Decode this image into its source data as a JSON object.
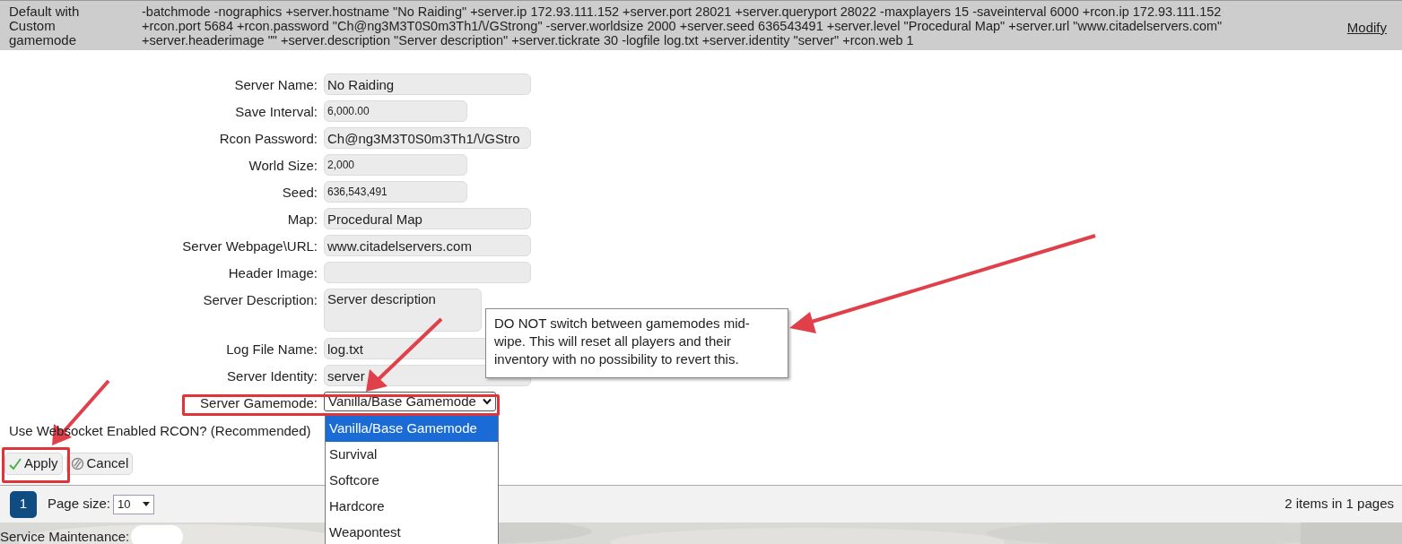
{
  "header_row": {
    "name_lines": [
      "Default with",
      "Custom",
      "gamemode"
    ],
    "command_lines": [
      "-batchmode -nographics +server.hostname \"No Raiding\" +server.ip 172.93.111.152 +server.port 28021 +server.queryport 28022 -maxplayers 15 -saveinterval 6000 +rcon.ip 172.93.111.152",
      "+rcon.port 5684 +rcon.password \"Ch@ng3M3T0S0m3Th1/\\/GStrong\" -server.worldsize 2000 +server.seed 636543491 +server.level \"Procedural Map\" +server.url \"www.citadelservers.com\"",
      "+server.headerimage \"\" +server.description \"Server description\" +server.tickrate 30 -logfile log.txt +server.identity \"server\" +rcon.web 1"
    ],
    "modify_link": "Modify"
  },
  "form": {
    "fields": [
      {
        "label": "Server Name:",
        "value": "No Raiding",
        "kind": "text"
      },
      {
        "label": "Save Interval:",
        "value": "6,000.00",
        "kind": "number"
      },
      {
        "label": "Rcon Password:",
        "value": "Ch@ng3M3T0S0m3Th1/\\/GStro",
        "kind": "text"
      },
      {
        "label": "World Size:",
        "value": "2,000",
        "kind": "number"
      },
      {
        "label": "Seed:",
        "value": "636,543,491",
        "kind": "number"
      },
      {
        "label": "Map:",
        "value": "Procedural Map",
        "kind": "text"
      },
      {
        "label": "Server Webpage\\URL:",
        "value": "www.citadelservers.com",
        "kind": "text"
      },
      {
        "label": "Header Image:",
        "kind": "text"
      },
      {
        "label": "Server Description:",
        "value": "Server description",
        "kind": "textarea"
      },
      {
        "label": "Log File Name:",
        "value": "log.txt",
        "kind": "text"
      },
      {
        "label": "Server Identity:",
        "value": "server",
        "kind": "text"
      }
    ],
    "gamemode": {
      "label": "Server Gamemode:",
      "value": "Vanilla/Base Gamemode",
      "expanded": true,
      "options": [
        {
          "label": "Vanilla/Base Gamemode",
          "selected": true
        },
        {
          "label": "Survival",
          "selected": false
        },
        {
          "label": "Softcore",
          "selected": false
        },
        {
          "label": "Hardcore",
          "selected": false
        },
        {
          "label": "Weapontest",
          "selected": false
        }
      ]
    },
    "websocket_label": "Use Websocket Enabled RCON? (Recommended)",
    "tooltip": "DO NOT switch between gamemodes mid-wipe. This will reset all players and their inventory with no possibility to revert this.",
    "buttons": [
      {
        "label": "Apply",
        "kind": "apply"
      },
      {
        "label": "Cancel",
        "kind": "cancel"
      }
    ]
  },
  "pager": {
    "pages": [
      {
        "label": "1",
        "selected": true
      }
    ],
    "page_size_label": "Page size:",
    "page_size": "10",
    "summary": "2 items in 1 pages"
  },
  "footer": {
    "maintenance_label": "Service Maintenance:",
    "maintenance_on": false
  }
}
